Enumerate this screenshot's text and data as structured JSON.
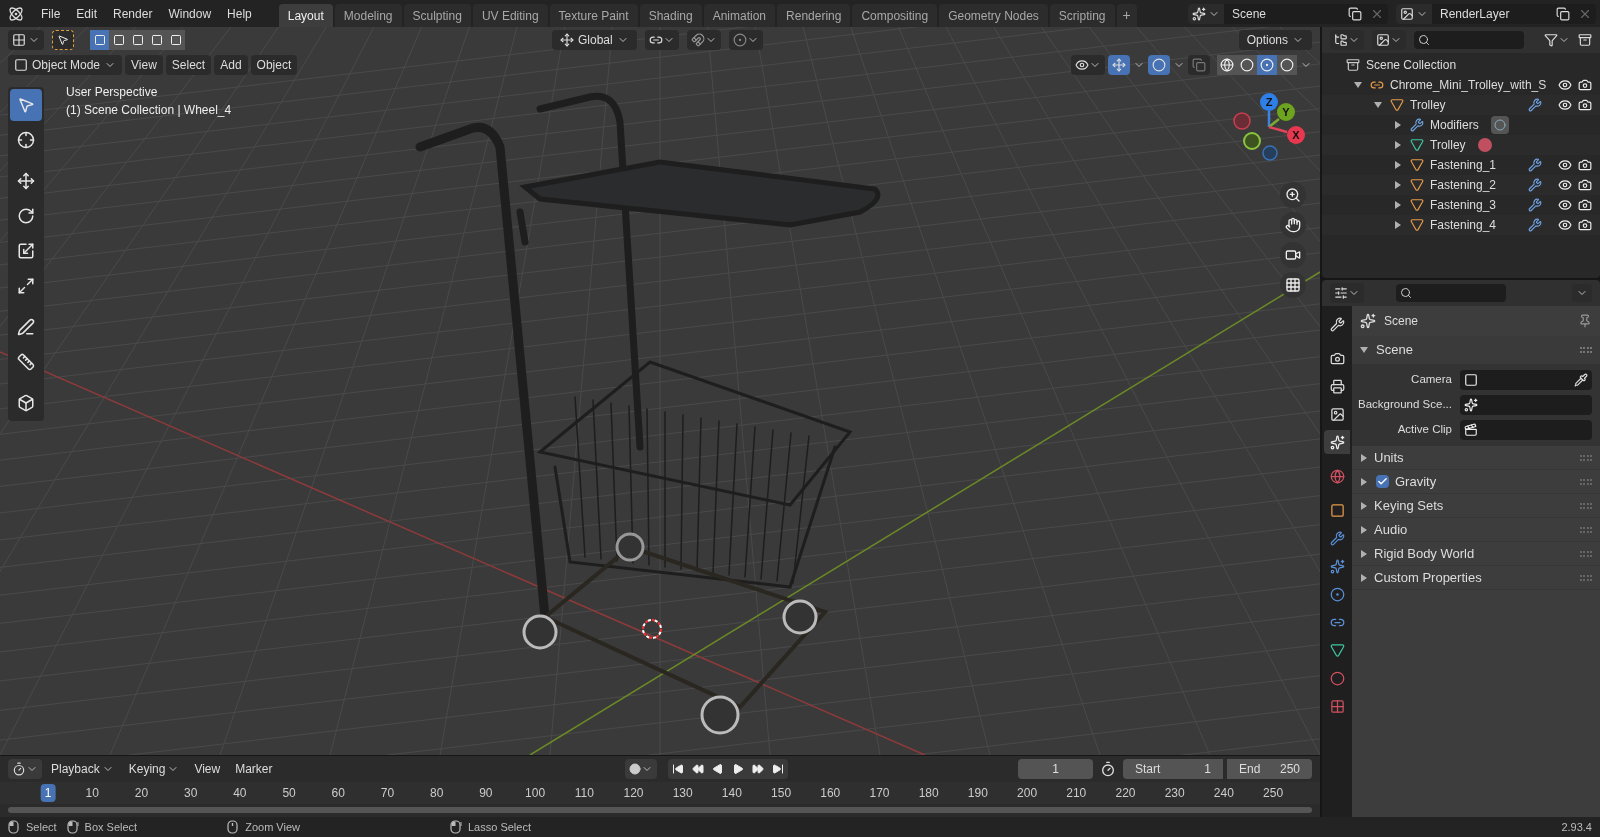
{
  "menu": [
    "File",
    "Edit",
    "Render",
    "Window",
    "Help"
  ],
  "workspaces": [
    {
      "label": "Layout",
      "selected": true
    },
    {
      "label": "Modeling",
      "selected": false
    },
    {
      "label": "Sculpting",
      "selected": false
    },
    {
      "label": "UV Editing",
      "selected": false
    },
    {
      "label": "Texture Paint",
      "selected": false
    },
    {
      "label": "Shading",
      "selected": false
    },
    {
      "label": "Animation",
      "selected": false
    },
    {
      "label": "Rendering",
      "selected": false
    },
    {
      "label": "Compositing",
      "selected": false
    },
    {
      "label": "Geometry Nodes",
      "selected": false
    },
    {
      "label": "Scripting",
      "selected": false
    }
  ],
  "add_workspace": "+",
  "scene": "Scene",
  "view_layer": "RenderLayer",
  "viewport": {
    "transform_orientation": "Global",
    "options": "Options",
    "snapping": false,
    "proportional_editing": false,
    "mode": "Object Mode",
    "menus": [
      "View",
      "Select",
      "Add",
      "Object"
    ],
    "overlay": [
      "User Perspective",
      "(1) Scene Collection | Wheel_4"
    ],
    "gizmo": [
      {
        "label": "Z",
        "color": "#2e7fe6"
      },
      {
        "label": "Y",
        "color": "#6ea31f"
      },
      {
        "label": "X",
        "color": "#e8384f"
      }
    ],
    "shading": [
      {
        "kind": "wire",
        "selected": false
      },
      {
        "kind": "solid",
        "selected": false
      },
      {
        "kind": "material",
        "selected": true
      },
      {
        "kind": "rendered",
        "selected": false
      }
    ],
    "tools": [
      {
        "kind": "select",
        "selected": true
      },
      {
        "kind": "cursor",
        "selected": false
      },
      {
        "kind": "move",
        "selected": false
      },
      {
        "kind": "rotate",
        "selected": false
      },
      {
        "kind": "scale",
        "selected": false
      },
      {
        "kind": "transform",
        "selected": false
      },
      {
        "kind": "annotate",
        "selected": false
      },
      {
        "kind": "measure",
        "selected": false
      },
      {
        "kind": "add-cube",
        "selected": false
      }
    ]
  },
  "outliner": {
    "root": "Scene Collection",
    "items": [
      {
        "name": "Chrome_Mini_Trolley_with_S",
        "kind": "empty",
        "expanded": true,
        "visible": true,
        "children": [
          {
            "name": "Trolley",
            "kind": "mesh",
            "expanded": true,
            "visible": true,
            "children": [
              {
                "name": "Modifiers",
                "kind": "modifiers",
                "expanded": false
              },
              {
                "name": "Trolley",
                "kind": "mesh-data",
                "expanded": false
              },
              {
                "name": "Fastening_1",
                "kind": "mesh",
                "expanded": false,
                "visible": true
              },
              {
                "name": "Fastening_2",
                "kind": "mesh",
                "expanded": false,
                "visible": true
              },
              {
                "name": "Fastening_3",
                "kind": "mesh",
                "expanded": false,
                "visible": true
              },
              {
                "name": "Fastening_4",
                "kind": "mesh",
                "expanded": false,
                "visible": true
              }
            ]
          }
        ]
      }
    ]
  },
  "properties": {
    "tabs": [
      {
        "kind": "tool",
        "selected": false
      },
      {
        "kind": "render",
        "selected": false
      },
      {
        "kind": "output",
        "selected": false
      },
      {
        "kind": "view-layer",
        "selected": false
      },
      {
        "kind": "scene",
        "selected": true
      },
      {
        "kind": "world",
        "selected": false
      },
      {
        "kind": "object",
        "selected": false
      },
      {
        "kind": "modifiers",
        "selected": false
      },
      {
        "kind": "particles",
        "selected": false
      },
      {
        "kind": "physics",
        "selected": false
      },
      {
        "kind": "constraints",
        "selected": false
      },
      {
        "kind": "data",
        "selected": false
      },
      {
        "kind": "material",
        "selected": false
      },
      {
        "kind": "texture",
        "selected": false
      }
    ],
    "context": "Scene",
    "panel": {
      "title": "Scene",
      "expanded": true,
      "fields": [
        {
          "label": "Camera",
          "kind": "camera"
        },
        {
          "label": "Background Sce...",
          "kind": "scene"
        },
        {
          "label": "Active Clip",
          "kind": "clip"
        }
      ]
    },
    "subpanels": [
      {
        "title": "Units",
        "expanded": false
      },
      {
        "title": "Gravity",
        "expanded": false,
        "checked": true
      },
      {
        "title": "Keying Sets",
        "expanded": false
      },
      {
        "title": "Audio",
        "expanded": false
      },
      {
        "title": "Rigid Body World",
        "expanded": false
      },
      {
        "title": "Custom Properties",
        "expanded": false
      }
    ]
  },
  "timeline": {
    "menus": [
      "Playback",
      "Keying",
      "View",
      "Marker"
    ],
    "current_frame": "1",
    "start_label": "Start",
    "start": "1",
    "end_label": "End",
    "end": "250",
    "ticks": [
      {
        "label": "1",
        "selected": true
      },
      {
        "label": "10",
        "selected": false
      },
      {
        "label": "20",
        "selected": false
      },
      {
        "label": "30",
        "selected": false
      },
      {
        "label": "40",
        "selected": false
      },
      {
        "label": "50",
        "selected": false
      },
      {
        "label": "60",
        "selected": false
      },
      {
        "label": "70",
        "selected": false
      },
      {
        "label": "80",
        "selected": false
      },
      {
        "label": "90",
        "selected": false
      },
      {
        "label": "100",
        "selected": false
      },
      {
        "label": "110",
        "selected": false
      },
      {
        "label": "120",
        "selected": false
      },
      {
        "label": "130",
        "selected": false
      },
      {
        "label": "140",
        "selected": false
      },
      {
        "label": "150",
        "selected": false
      },
      {
        "label": "160",
        "selected": false
      },
      {
        "label": "170",
        "selected": false
      },
      {
        "label": "180",
        "selected": false
      },
      {
        "label": "190",
        "selected": false
      },
      {
        "label": "200",
        "selected": false
      },
      {
        "label": "210",
        "selected": false
      },
      {
        "label": "220",
        "selected": false
      },
      {
        "label": "230",
        "selected": false
      },
      {
        "label": "240",
        "selected": false
      },
      {
        "label": "250",
        "selected": false
      }
    ]
  },
  "status_bar": {
    "hints": [
      {
        "label": "Select",
        "kind": "left"
      },
      {
        "label": "Box Select",
        "kind": "drag"
      },
      {
        "label": "Zoom View",
        "kind": "middle"
      },
      {
        "label": "Lasso Select",
        "kind": "drag"
      }
    ],
    "version": "2.93.4"
  }
}
